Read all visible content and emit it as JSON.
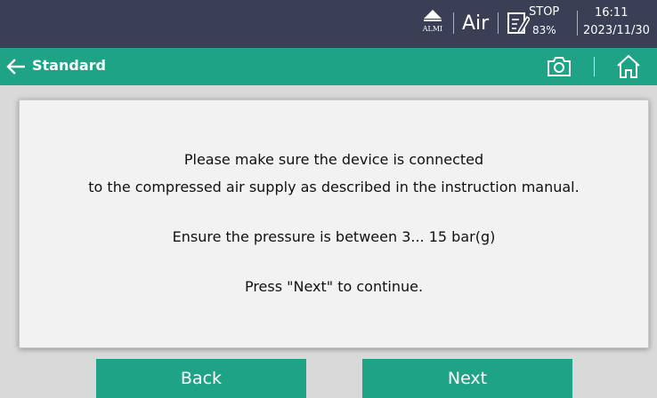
{
  "status_bar": {
    "alarm_label": "ALMI",
    "medium": "Air",
    "device_state": "STOP",
    "battery_percent": "83%",
    "time": "16:11",
    "date": "2023/11/30"
  },
  "title_bar": {
    "title": "Standard",
    "icons": [
      "back-arrow-icon",
      "camera-icon",
      "home-icon"
    ]
  },
  "dialog": {
    "line1": "Please make sure the device is connected",
    "line2": "to the compressed air supply as described in the instruction manual.",
    "line3": "Ensure the pressure is between 3... 15 bar(g)",
    "line4": "Press \"Next\" to continue."
  },
  "buttons": {
    "back_label": "Back",
    "next_label": "Next"
  },
  "colors": {
    "status_bar_bg": "#3b3f55",
    "accent_green": "#1fa386",
    "page_bg": "#d9d9d9",
    "dialog_bg": "#f2f2f2"
  }
}
